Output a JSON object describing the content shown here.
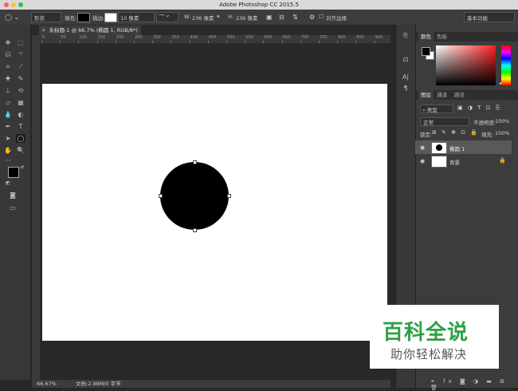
{
  "window": {
    "title": "Adobe Photoshop CC 2015.5"
  },
  "options_bar": {
    "mode": "形状",
    "fill_label": "填充:",
    "stroke_label": "描边:",
    "stroke_width": "10 像素",
    "w_label": "W:",
    "w_value": "236 像素",
    "h_label": "H:",
    "h_value": "236 像素",
    "align_edges": "对齐边缘",
    "workspace": "基本功能"
  },
  "document_tab": {
    "title": "未标题-1 @ 66.7% (椭圆 1, RGB/8*) *"
  },
  "ruler_top_labels": [
    "0",
    "50",
    "100",
    "150",
    "200",
    "250",
    "300",
    "350",
    "400",
    "450",
    "500",
    "550",
    "600",
    "650",
    "700",
    "750",
    "800",
    "850",
    "900"
  ],
  "status_bar": {
    "zoom": "66.67%",
    "doc_info": "文档:2.98M/0 字节"
  },
  "color_panel": {
    "tabs": [
      "颜色",
      "色板"
    ]
  },
  "layers_panel": {
    "tabs": [
      "图层",
      "通道",
      "路径"
    ],
    "filter_kind": "类型",
    "blend_mode": "正常",
    "opacity_label": "不透明度:",
    "opacity_value": "100%",
    "lock_label": "锁定:",
    "fill_label": "填充:",
    "fill_value": "100%",
    "layers": [
      {
        "name": "椭圆 1"
      },
      {
        "name": "背景"
      }
    ]
  },
  "watermark": {
    "title": "百科全说",
    "subtitle": "助你轻松解决"
  },
  "colors": {
    "foreground": "#000000",
    "background": "#ffffff",
    "watermark_green": "#2ea043"
  }
}
